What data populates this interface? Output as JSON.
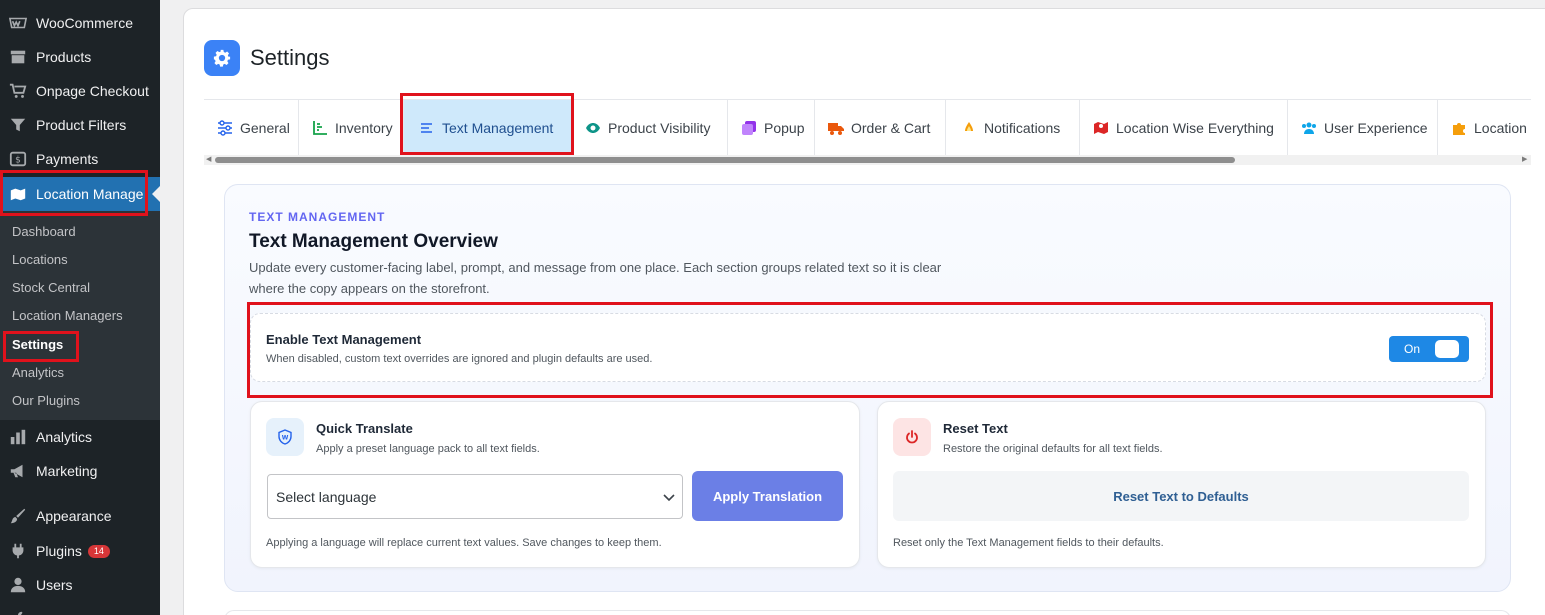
{
  "sidebar": {
    "menu": [
      {
        "label": "WooCommerce",
        "icon": "woocommerce-icon"
      },
      {
        "label": "Products",
        "icon": "archive-icon"
      },
      {
        "label": "Onpage Checkout",
        "icon": "cart-icon"
      },
      {
        "label": "Product Filters",
        "icon": "filter-icon"
      },
      {
        "label": "Payments",
        "icon": "money-icon"
      },
      {
        "label": "Location Manage",
        "icon": "location-map-icon",
        "active": true
      }
    ],
    "submenu": [
      "Dashboard",
      "Locations",
      "Stock Central",
      "Location Managers",
      "Settings",
      "Analytics",
      "Our Plugins"
    ],
    "submenu_current": "Settings",
    "menu_bottom": [
      {
        "label": "Analytics",
        "icon": "bar-chart-icon"
      },
      {
        "label": "Marketing",
        "icon": "megaphone-icon"
      },
      {
        "label": "Appearance",
        "icon": "brush-icon"
      },
      {
        "label": "Plugins",
        "icon": "plug-icon",
        "badge": "14"
      },
      {
        "label": "Users",
        "icon": "user-icon"
      }
    ]
  },
  "page": {
    "title": "Settings",
    "icon": "gear-icon",
    "accent": "#3b82f6"
  },
  "tabs": [
    {
      "label": "General",
      "icon": "sliders-icon",
      "color": "#2563eb"
    },
    {
      "label": "Inventory",
      "icon": "chart-line-icon",
      "color": "#16a34a"
    },
    {
      "label": "Text Management",
      "icon": "align-left-icon",
      "color": "#2563eb",
      "active": true
    },
    {
      "label": "Product Visibility",
      "icon": "eye-icon",
      "color": "#0d9488"
    },
    {
      "label": "Popup",
      "icon": "clone-icon",
      "color": "#9333ea"
    },
    {
      "label": "Order & Cart",
      "icon": "truck-icon",
      "color": "#ea580c"
    },
    {
      "label": "Notifications",
      "icon": "bell-icon",
      "color": "#f59e0b"
    },
    {
      "label": "Location Wise Everything",
      "icon": "map-icon",
      "color": "#dc2626"
    },
    {
      "label": "User Experience",
      "icon": "users-icon",
      "color": "#0ea5e9"
    },
    {
      "label": "Location",
      "icon": "puzzle-icon",
      "color": "#f59e0b"
    }
  ],
  "section": {
    "eyebrow": "TEXT MANAGEMENT",
    "title": "Text Management Overview",
    "description": "Update every customer-facing label, prompt, and message from one place. Each section groups related text so it is clear where the copy appears on the storefront."
  },
  "enable": {
    "title": "Enable Text Management",
    "description": "When disabled, custom text overrides are ignored and plugin defaults are used.",
    "toggle_label": "On",
    "enabled": true
  },
  "quick_translate": {
    "title": "Quick Translate",
    "description": "Apply a preset language pack to all text fields.",
    "select_value": "Select language",
    "button_label": "Apply Translation",
    "note": "Applying a language will replace current text values. Save changes to keep them."
  },
  "reset": {
    "title": "Reset Text",
    "description": "Restore the original defaults for all text fields.",
    "button_label": "Reset Text to Defaults",
    "note": "Reset only the Text Management fields to their defaults."
  }
}
